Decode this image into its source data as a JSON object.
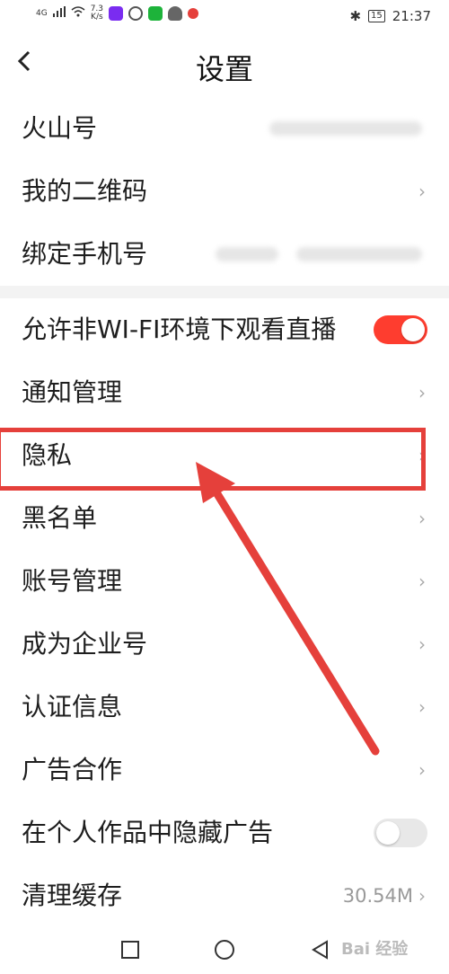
{
  "statusbar": {
    "network": "4G",
    "speed_value": "7.3",
    "speed_unit": "K/s",
    "battery": "15",
    "time": "21:37"
  },
  "header": {
    "back_icon": "chevron-left-icon",
    "title": "设置"
  },
  "items": [
    {
      "label": "火山号"
    },
    {
      "label": "我的二维码"
    },
    {
      "label": "绑定手机号"
    },
    {
      "label": "允许非WI-FI环境下观看直播",
      "toggle": "on"
    },
    {
      "label": "通知管理"
    },
    {
      "label": "隐私"
    },
    {
      "label": "黑名单"
    },
    {
      "label": "账号管理"
    },
    {
      "label": "成为企业号"
    },
    {
      "label": "认证信息"
    },
    {
      "label": "广告合作"
    },
    {
      "label": "在个人作品中隐藏广告",
      "toggle": "off"
    },
    {
      "label": "清理缓存",
      "value": "30.54M"
    }
  ],
  "watermark": "Bai 经验",
  "colors": {
    "accent": "#fe3d2f",
    "annotation": "#e5403b",
    "toggle_off": "#e8e8e8"
  }
}
